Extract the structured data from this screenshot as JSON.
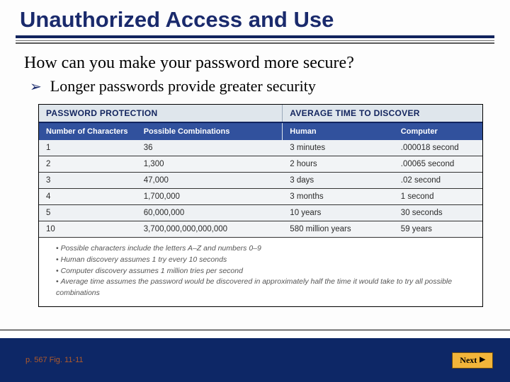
{
  "slide": {
    "title": "Unauthorized Access and Use",
    "question": "How can you make your password more secure?",
    "bullet": "Longer passwords provide greater security"
  },
  "table": {
    "group_left": "PASSWORD PROTECTION",
    "group_right": "AVERAGE TIME TO DISCOVER",
    "headers": {
      "num_chars": "Number of Characters",
      "combos": "Possible Combinations",
      "human": "Human",
      "computer": "Computer"
    },
    "rows": [
      {
        "n": "1",
        "combos": "36",
        "human": "3 minutes",
        "computer": ".000018 second"
      },
      {
        "n": "2",
        "combos": "1,300",
        "human": "2 hours",
        "computer": ".00065 second"
      },
      {
        "n": "3",
        "combos": "47,000",
        "human": "3 days",
        "computer": ".02 second"
      },
      {
        "n": "4",
        "combos": "1,700,000",
        "human": "3 months",
        "computer": "1 second"
      },
      {
        "n": "5",
        "combos": "60,000,000",
        "human": "10 years",
        "computer": "30 seconds"
      },
      {
        "n": "10",
        "combos": "3,700,000,000,000,000",
        "human": "580 million years",
        "computer": "59 years"
      }
    ],
    "footnotes": [
      "Possible characters include the letters A–Z and numbers 0–9",
      "Human discovery assumes 1 try every 10 seconds",
      "Computer discovery assumes 1 million tries per second",
      "Average time assumes the password would be discovered in approximately half the time it would take to try all possible combinations"
    ]
  },
  "footer": {
    "page_ref": "p. 567 Fig. 11-11",
    "next_label": "Next"
  },
  "chart_data": {
    "type": "table",
    "title": "Password Protection — Average Time to Discover",
    "columns": [
      "Number of Characters",
      "Possible Combinations",
      "Human",
      "Computer"
    ],
    "rows": [
      [
        "1",
        "36",
        "3 minutes",
        ".000018 second"
      ],
      [
        "2",
        "1,300",
        "2 hours",
        ".00065 second"
      ],
      [
        "3",
        "47,000",
        "3 days",
        ".02 second"
      ],
      [
        "4",
        "1,700,000",
        "3 months",
        "1 second"
      ],
      [
        "5",
        "60,000,000",
        "10 years",
        "30 seconds"
      ],
      [
        "10",
        "3,700,000,000,000,000",
        "580 million years",
        "59 years"
      ]
    ]
  }
}
